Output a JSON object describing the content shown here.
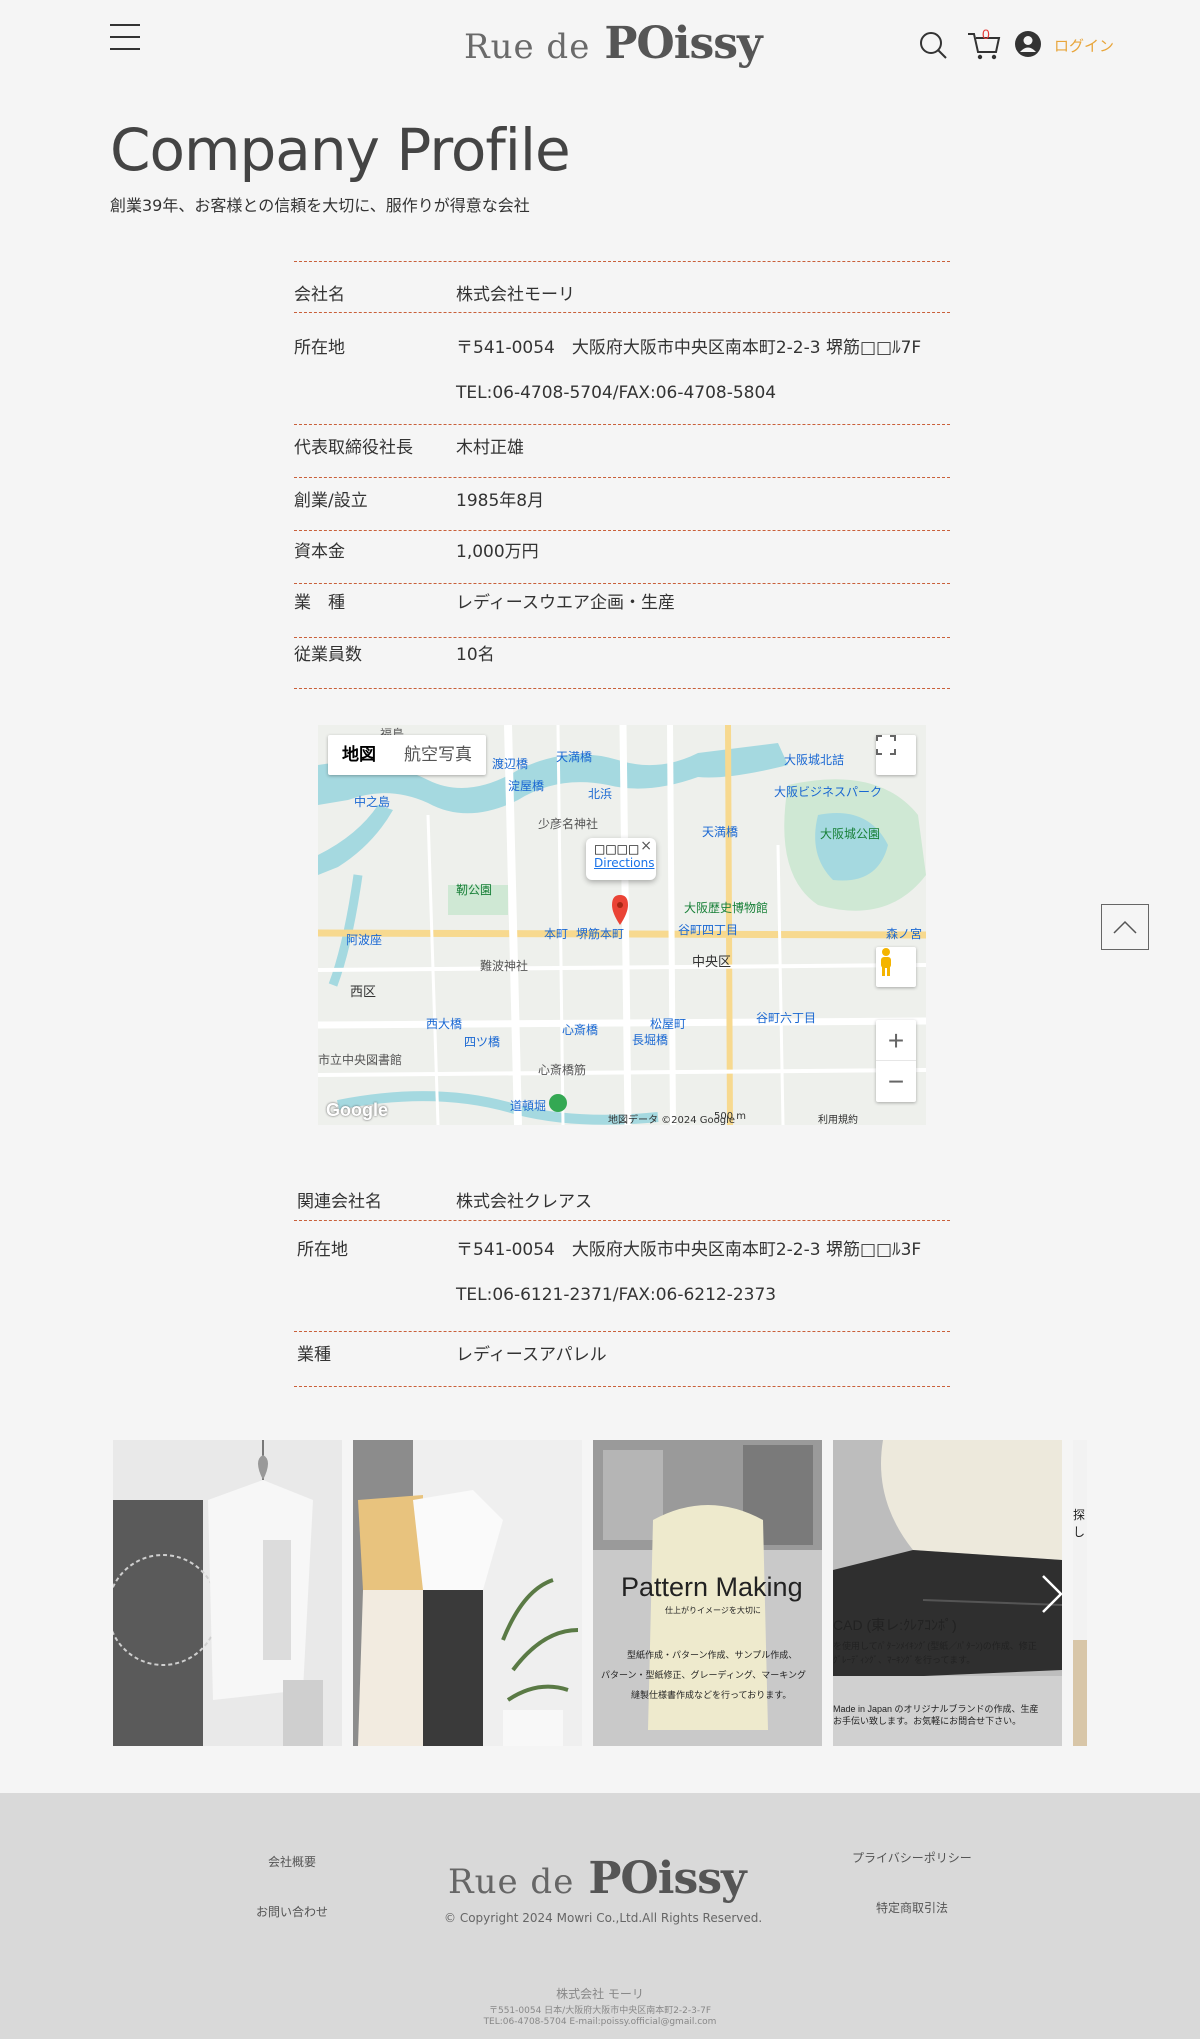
{
  "header": {
    "logo_rue": "Rue de",
    "logo_poissy": "POissy",
    "cart_count": "0",
    "login_label": "ログイン"
  },
  "title": {
    "main": "Company Profile",
    "subtitle": "創業39年、お客様との信頼を大切に、服作りが得意な会社"
  },
  "company": {
    "rows": [
      {
        "label": "会社名",
        "value": "株式会社モーリ"
      },
      {
        "label": "所在地",
        "value": "〒541-0054　大阪府大阪市中央区南本町2-2-3 堺筋□□ﾙ7F",
        "value2": "TEL:06-4708-5704/FAX:06-4708-5804"
      },
      {
        "label": "代表取締役社長",
        "value": "木村正雄"
      },
      {
        "label": "創業/設立",
        "value": "1985年8月"
      },
      {
        "label": "資本金",
        "value": "1,000万円"
      },
      {
        "label": "業　種",
        "value": "レディースウエア企画・生産"
      },
      {
        "label": "従業員数",
        "value": "10名"
      }
    ]
  },
  "map": {
    "toggle_map": "地図",
    "toggle_satellite": "航空写真",
    "infowindow_title": "□□□□",
    "infowindow_link": "Directions",
    "zoom_in": "+",
    "zoom_out": "−",
    "google": "Google",
    "copyright": "地図データ ©2024 Google",
    "scale": "500 m",
    "terms": "利用規約",
    "labels": [
      {
        "text": "福島",
        "cls": "dark"
      },
      {
        "text": "天満橋",
        "cls": "blue"
      },
      {
        "text": "大阪城北詰",
        "cls": "blue"
      },
      {
        "text": "渡辺橋",
        "cls": "blue"
      },
      {
        "text": "淀屋橋",
        "cls": "blue"
      },
      {
        "text": "北浜",
        "cls": "blue"
      },
      {
        "text": "大阪ビジネスパーク",
        "cls": "blue"
      },
      {
        "text": "中之島",
        "cls": "blue"
      },
      {
        "text": "少彦名神社",
        "cls": "dark"
      },
      {
        "text": "天満橋",
        "cls": "blue"
      },
      {
        "text": "大阪城公園",
        "cls": "green"
      },
      {
        "text": "靭公園",
        "cls": "green"
      },
      {
        "text": "大阪歴史博物館",
        "cls": "green"
      },
      {
        "text": "阿波座",
        "cls": "blue"
      },
      {
        "text": "本町",
        "cls": "blue"
      },
      {
        "text": "堺筋本町",
        "cls": "blue"
      },
      {
        "text": "谷町四丁目",
        "cls": "blue"
      },
      {
        "text": "森ノ宮",
        "cls": "blue"
      },
      {
        "text": "難波神社",
        "cls": "dark"
      },
      {
        "text": "中央区",
        "cls": "dark"
      },
      {
        "text": "西区",
        "cls": "dark"
      },
      {
        "text": "西大橋",
        "cls": "blue"
      },
      {
        "text": "四ツ橋",
        "cls": "blue"
      },
      {
        "text": "心斎橋",
        "cls": "blue"
      },
      {
        "text": "長堀橋",
        "cls": "blue"
      },
      {
        "text": "松屋町",
        "cls": "blue"
      },
      {
        "text": "谷町六丁目",
        "cls": "blue"
      },
      {
        "text": "市立中央図書館",
        "cls": "dark"
      },
      {
        "text": "心斎橋筋",
        "cls": "dark"
      },
      {
        "text": "道頓堀",
        "cls": "blue"
      }
    ]
  },
  "related": {
    "rows": [
      {
        "label": "関連会社名",
        "value": "株式会社クレアス"
      },
      {
        "label": "所在地",
        "value": "〒541-0054　大阪府大阪市中央区南本町2-2-3 堺筋□□ﾙ3F",
        "value2": "TEL:06-6121-2371/FAX:06-6212-2373"
      },
      {
        "label": "業種",
        "value": "レディースアパレル"
      }
    ]
  },
  "gallery": {
    "item3_title": "Pattern Making",
    "item3_sub": "仕上がりイメージを大切に",
    "item3_line1": "型紙作成・パターン作成、サンプル作成、",
    "item3_line2": "パターン・型紙修正、グレーディング、マーキング",
    "item3_line3": "縫製仕様書作成などを行っております。",
    "item4_title": "CAD (東レ:ｸﾚｱｺﾝﾎﾟ)",
    "item4_line1": "を使用してﾊﾟﾀｰﾝﾒｲｷﾝｸﾞ(型紙／ﾊﾟﾀｰﾝ)の作成、修正",
    "item4_line2": "ｸﾞﾚｰﾃﾞｨﾝｸﾞ、ﾏｰｷﾝｸﾞを行ってます。",
    "item4_line3": "Made in Japan のオリジナルブランドの作成、生産",
    "item4_line4": "お手伝い致します。お気軽にお問合せ下さい。",
    "item5_text": "探し"
  },
  "footer": {
    "link_about": "会社概要",
    "link_contact": "お問い合わせ",
    "link_privacy": "プライバシーポリシー",
    "link_law": "特定商取引法",
    "logo_rue": "Rue de",
    "logo_poissy": "POissy",
    "copyright": "© Copyright 2024 Mowri Co.,Ltd.All Rights Reserved.",
    "company_name": "株式会社 モーリ",
    "address": "〒551-0054 日本/大阪府大阪市中央区南本町2-2-3-7F",
    "contact": "TEL:06-4708-5704 E-mail:poissy.official@gmail.com"
  },
  "colors": {
    "accent": "#e8a53a",
    "divider": "#c9603a",
    "cart_badge": "#e53935"
  }
}
